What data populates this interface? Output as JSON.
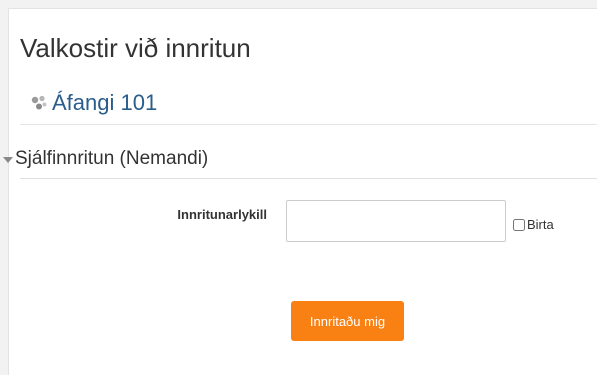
{
  "page": {
    "title": "Valkostir við innritun"
  },
  "course": {
    "name": "Áfangi 101",
    "icon": "course-icon"
  },
  "enrol_section": {
    "title": "Sjálfinnritun (Nemandi)",
    "collapse_icon": "triangle-down-icon"
  },
  "form": {
    "enrolment_key_label": "Innritunarlykill",
    "enrolment_key_value": "",
    "show_label": "Birta",
    "show_checked": false,
    "submit_label": "Innritaðu mig"
  },
  "colors": {
    "accent": "#f98012",
    "link": "#2b5d8c"
  }
}
